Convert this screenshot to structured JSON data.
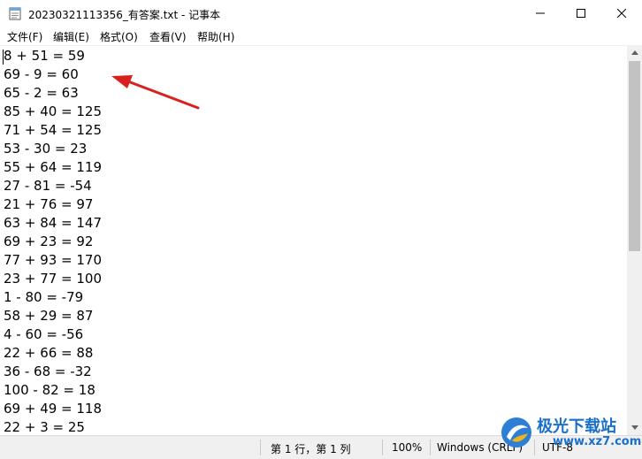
{
  "window": {
    "title": "20230321113356_有答案.txt - 记事本",
    "controls": {
      "minimize_icon": "minimize-icon",
      "maximize_icon": "maximize-icon",
      "close_icon": "close-icon"
    }
  },
  "menu": {
    "items": [
      {
        "label": "文件(F)"
      },
      {
        "label": "编辑(E)"
      },
      {
        "label": "格式(O)"
      },
      {
        "label": "查看(V)"
      },
      {
        "label": "帮助(H)"
      }
    ]
  },
  "editor": {
    "lines": [
      "8 + 51 = 59",
      "69 - 9 = 60",
      "65 - 2 = 63",
      "85 + 40 = 125",
      "71 + 54 = 125",
      "53 - 30 = 23",
      "55 + 64 = 119",
      "27 - 81 = -54",
      "21 + 76 = 97",
      "63 + 84 = 147",
      "69 + 23 = 92",
      "77 + 93 = 170",
      "23 + 77 = 100",
      "1 - 80 = -79",
      "58 + 29 = 87",
      "4 - 60 = -56",
      "22 + 66 = 88",
      "36 - 68 = -32",
      "100 - 82 = 18",
      "69 + 49 = 118",
      "22 + 3 = 25"
    ]
  },
  "statusbar": {
    "position": "第 1 行，第 1 列",
    "zoom": "100%",
    "line_ending": "Windows (CRLF)",
    "encoding": "UTF-8"
  },
  "watermark": {
    "name": "极光下载站",
    "url": "www.xz7.com"
  },
  "colors": {
    "annotation_arrow": "#d9201c",
    "watermark_blue": "#1a6fc9"
  }
}
